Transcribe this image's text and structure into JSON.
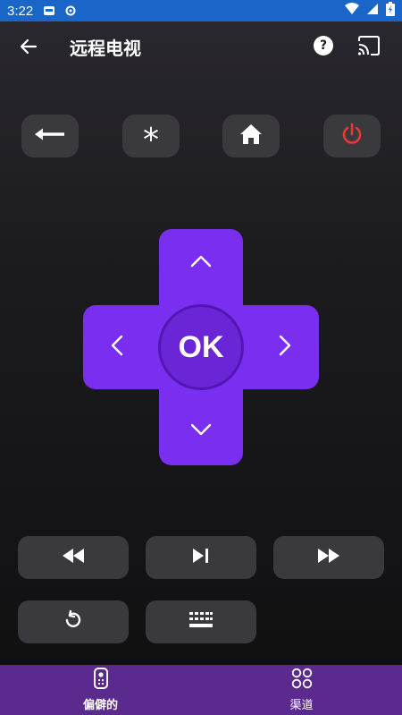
{
  "status_bar": {
    "time": "3:22"
  },
  "app_bar": {
    "title": "远程电视",
    "help_glyph": "?"
  },
  "top_buttons": [
    {
      "name": "back",
      "icon": "long-arrow-left-icon"
    },
    {
      "name": "options",
      "glyph": "*",
      "icon": "asterisk-icon"
    },
    {
      "name": "home",
      "icon": "home-icon"
    },
    {
      "name": "power",
      "icon": "power-icon",
      "color": "#e53935"
    }
  ],
  "dpad": {
    "ok_label": "OK",
    "color": "#7a2ff0",
    "center_color": "#6a26d6"
  },
  "media_buttons": [
    {
      "name": "rewind",
      "icon": "rewind-icon"
    },
    {
      "name": "play-pause",
      "icon": "play-pause-icon"
    },
    {
      "name": "fast-forward",
      "icon": "fast-forward-icon"
    },
    {
      "name": "replay",
      "icon": "replay-icon"
    },
    {
      "name": "keyboard",
      "icon": "keyboard-icon"
    }
  ],
  "bottom_nav": {
    "items": [
      {
        "label": "偏僻的",
        "icon": "remote-icon",
        "active": true
      },
      {
        "label": "渠道",
        "icon": "grid-circles-icon",
        "active": false
      }
    ]
  },
  "colors": {
    "accent": "#7a2ff0",
    "bottom_nav_bg": "#5b2a8f",
    "status_bar_bg": "#1a66c8",
    "button_bg": "#3a393d"
  }
}
